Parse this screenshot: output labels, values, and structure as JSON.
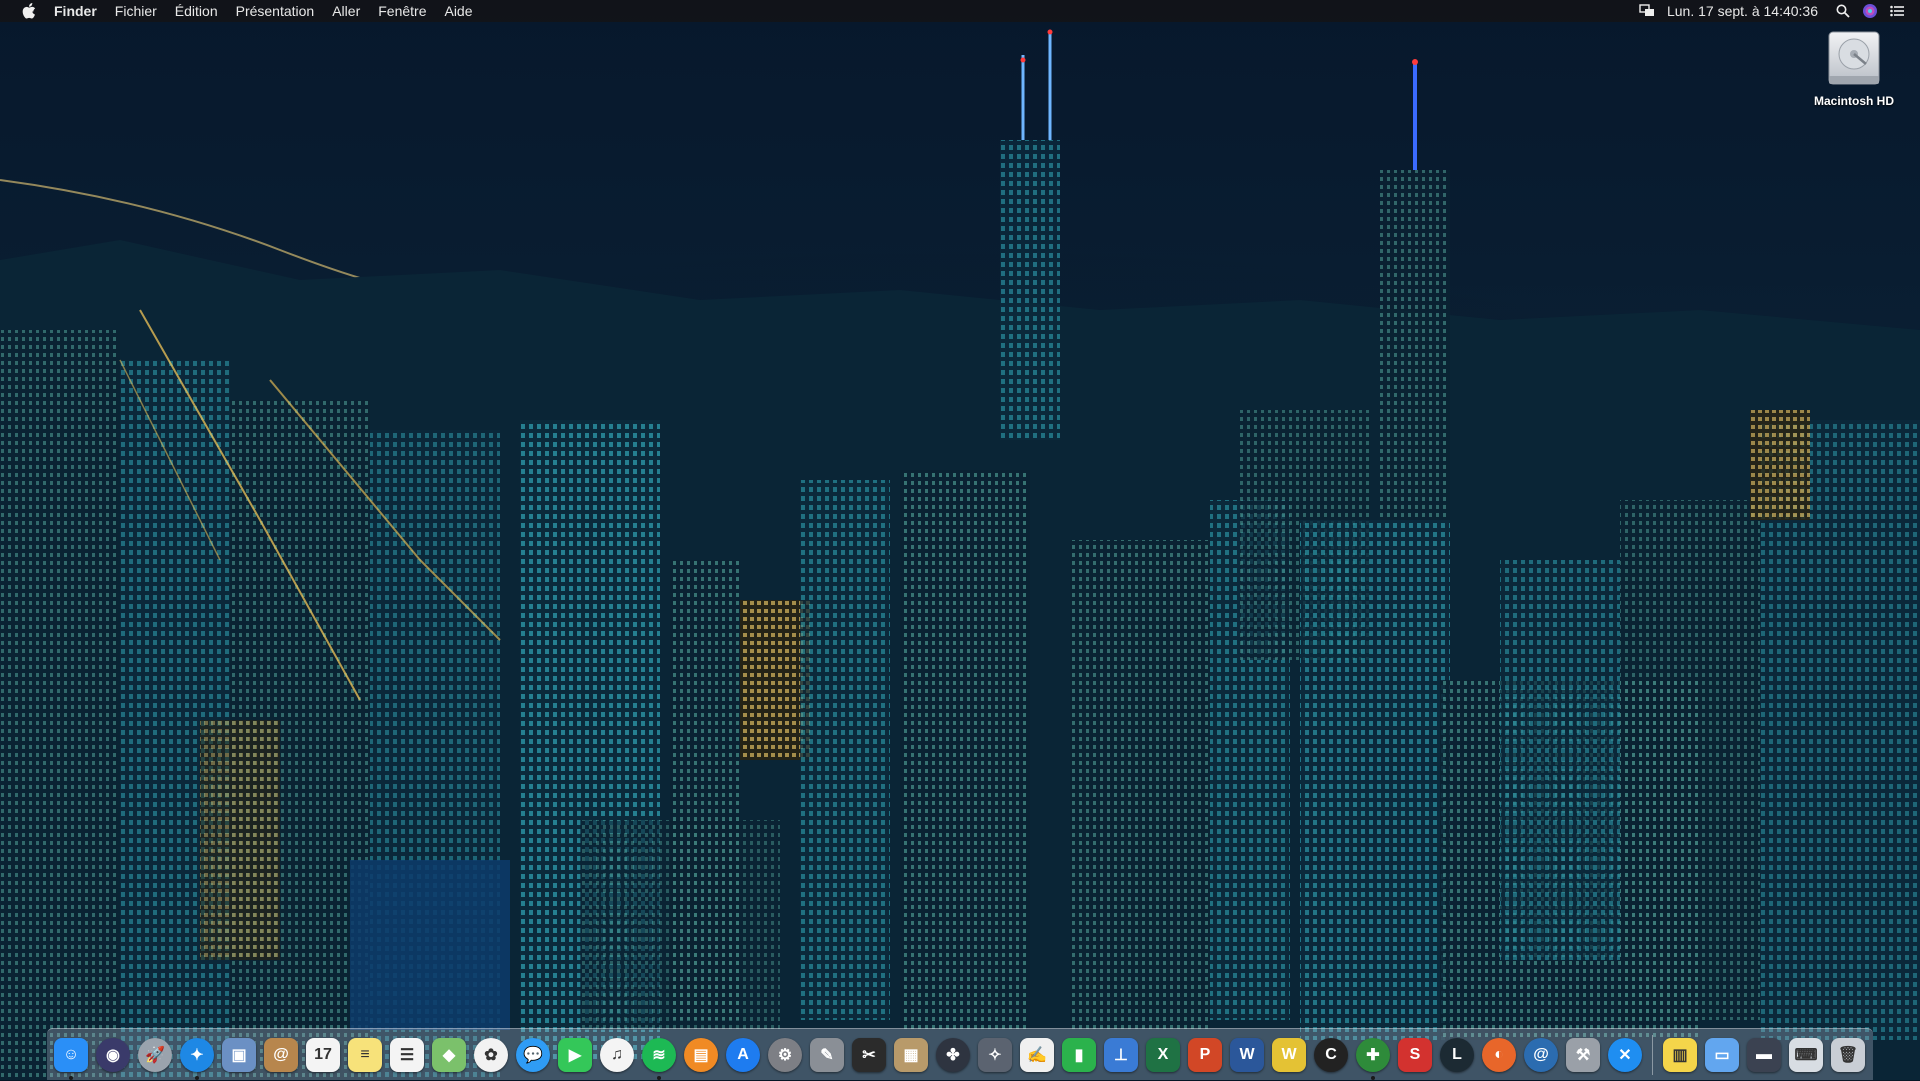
{
  "menubar": {
    "app_name": "Finder",
    "menus": [
      "Fichier",
      "Édition",
      "Présentation",
      "Aller",
      "Fenêtre",
      "Aide"
    ],
    "clock": "Lun. 17 sept. à  14:40:36"
  },
  "desktop": {
    "icons": [
      {
        "label": "Macintosh HD",
        "icon": "hard-drive-icon"
      }
    ]
  },
  "dock": {
    "apps": [
      {
        "name": "finder-icon",
        "color": "#2a8ff7",
        "glyph": "☺",
        "running": true
      },
      {
        "name": "siri-icon",
        "color": "#3a3a6a",
        "glyph": "◉",
        "running": false,
        "round": true
      },
      {
        "name": "launchpad-icon",
        "color": "#9aa3ad",
        "glyph": "🚀",
        "running": false,
        "round": true
      },
      {
        "name": "safari-icon",
        "color": "#1e88e5",
        "glyph": "✦",
        "running": true,
        "round": true
      },
      {
        "name": "preview-icon",
        "color": "#6b90c4",
        "glyph": "▣",
        "running": false
      },
      {
        "name": "contacts-icon",
        "color": "#b7864d",
        "glyph": "@",
        "running": false
      },
      {
        "name": "calendar-icon",
        "color": "#f4f4f4",
        "glyph": "17",
        "running": false,
        "dark": true
      },
      {
        "name": "notes-icon",
        "color": "#f7e27a",
        "glyph": "≡",
        "running": false,
        "dark": true
      },
      {
        "name": "reminders-icon",
        "color": "#f4f4f4",
        "glyph": "☰",
        "running": false,
        "dark": true
      },
      {
        "name": "maps-icon",
        "color": "#7bc16b",
        "glyph": "◆",
        "running": false
      },
      {
        "name": "photos-icon",
        "color": "#f2f2f2",
        "glyph": "✿",
        "running": false,
        "dark": true,
        "round": true
      },
      {
        "name": "messages-icon",
        "color": "#2f9cf5",
        "glyph": "💬",
        "running": false,
        "round": true
      },
      {
        "name": "facetime-icon",
        "color": "#34c759",
        "glyph": "▶",
        "running": false
      },
      {
        "name": "itunes-icon",
        "color": "#f4f4f4",
        "glyph": "♫",
        "running": false,
        "dark": true,
        "round": true
      },
      {
        "name": "spotify-icon",
        "color": "#1db954",
        "glyph": "≋",
        "running": true,
        "round": true
      },
      {
        "name": "ibooks-icon",
        "color": "#f08a24",
        "glyph": "▤",
        "running": false,
        "round": true
      },
      {
        "name": "app-store-icon",
        "color": "#1e7cf0",
        "glyph": "A",
        "running": false,
        "round": true
      },
      {
        "name": "system-preferences-icon",
        "color": "#7d7f85",
        "glyph": "⚙",
        "running": false,
        "round": true
      },
      {
        "name": "script-editor-icon",
        "color": "#8a8f96",
        "glyph": "✎",
        "running": false
      },
      {
        "name": "final-cut-icon",
        "color": "#2b2b2b",
        "glyph": "✂",
        "running": false
      },
      {
        "name": "archive-icon",
        "color": "#b89a6a",
        "glyph": "▦",
        "running": false
      },
      {
        "name": "davinci-resolve-icon",
        "color": "#2e3440",
        "glyph": "✤",
        "running": false,
        "round": true
      },
      {
        "name": "utility-icon",
        "color": "#5b6370",
        "glyph": "✧",
        "running": false
      },
      {
        "name": "textedit-icon",
        "color": "#f0f0f0",
        "glyph": "✍",
        "running": false,
        "dark": true
      },
      {
        "name": "numbers-icon",
        "color": "#2bb24c",
        "glyph": "▮",
        "running": false
      },
      {
        "name": "keynote-icon",
        "color": "#3a7bd5",
        "glyph": "⊥",
        "running": false
      },
      {
        "name": "excel-icon",
        "color": "#1f7244",
        "glyph": "X",
        "running": false
      },
      {
        "name": "powerpoint-icon",
        "color": "#d24726",
        "glyph": "P",
        "running": false
      },
      {
        "name": "word-icon",
        "color": "#2b579a",
        "glyph": "W",
        "running": false
      },
      {
        "name": "wunderlist-icon",
        "color": "#e4c234",
        "glyph": "W",
        "running": false
      },
      {
        "name": "ccleaner-icon",
        "color": "#222222",
        "glyph": "C",
        "running": false,
        "round": true
      },
      {
        "name": "green-app-icon",
        "color": "#2e8b3a",
        "glyph": "✚",
        "running": true,
        "round": true
      },
      {
        "name": "sketchup-icon",
        "color": "#d3322f",
        "glyph": "S",
        "running": false
      },
      {
        "name": "league-icon",
        "color": "#1c2a33",
        "glyph": "L",
        "running": false,
        "round": true
      },
      {
        "name": "firefox-icon",
        "color": "#e8662a",
        "glyph": "◐",
        "running": false,
        "round": true
      },
      {
        "name": "spiral-app-icon",
        "color": "#2b6cb0",
        "glyph": "@",
        "running": false,
        "round": true
      },
      {
        "name": "utility-tool-icon",
        "color": "#9aa0a8",
        "glyph": "⚒",
        "running": false
      },
      {
        "name": "xcode-icon",
        "color": "#1f8ef1",
        "glyph": "✕",
        "running": false,
        "round": true
      }
    ],
    "stacks": [
      {
        "name": "stickies-icon",
        "color": "#f4d54a",
        "glyph": "▥",
        "dark": true
      },
      {
        "name": "folder-icon",
        "color": "#62a6ef",
        "glyph": "▭"
      },
      {
        "name": "screen-recording-icon",
        "color": "#3b4251",
        "glyph": "▬"
      },
      {
        "name": "keyboard-icon",
        "color": "#d8dde3",
        "glyph": "⌨",
        "dark": true
      },
      {
        "name": "trash-icon",
        "color": "#c9ced5",
        "glyph": "🗑",
        "dark": true
      }
    ]
  }
}
